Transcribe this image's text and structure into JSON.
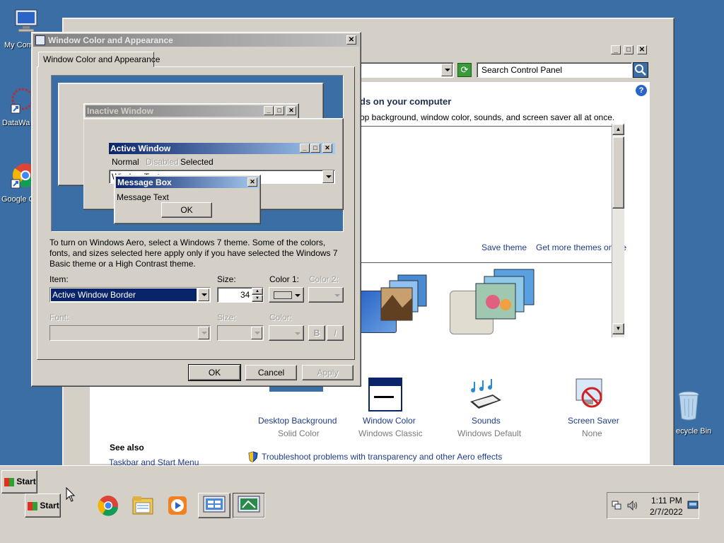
{
  "desktop": {
    "icons": [
      {
        "label": "My Com",
        "icon": "computer-icon"
      },
      {
        "label": "DataWa",
        "icon": "datawatch-icon"
      },
      {
        "label": "Google C",
        "icon": "chrome-icon"
      },
      {
        "label": "ecycle Bin",
        "icon": "recycle-bin-icon"
      }
    ]
  },
  "control_panel": {
    "search_placeholder": "Search Control Panel",
    "heading": "ds on your computer",
    "subheading": "op background, window color, sounds, and screen saver all at once.",
    "save_theme": "Save theme",
    "get_more_themes": "Get more themes online",
    "items": [
      {
        "label": "Desktop Background",
        "sub": "Solid Color"
      },
      {
        "label": "Window Color",
        "sub": "Windows Classic"
      },
      {
        "label": "Sounds",
        "sub": "Windows Default"
      },
      {
        "label": "Screen Saver",
        "sub": "None"
      }
    ],
    "see_also": "See also",
    "taskbar_link": "Taskbar and Start Menu",
    "troubleshoot": "Troubleshoot problems with transparency and other Aero effects"
  },
  "dialog": {
    "title": "Window Color and Appearance",
    "tab": "Window Color and Appearance",
    "preview": {
      "inactive_title": "Inactive Window",
      "active_title": "Active Window",
      "menu_normal": "Normal",
      "menu_disabled": "Disabled",
      "menu_selected": "Selected",
      "window_text": "Window Text",
      "msgbox_title": "Message Box",
      "msgbox_text": "Message Text",
      "msgbox_ok": "OK"
    },
    "info_text": "To turn on Windows Aero, select a Windows 7 theme.  Some of the colors, fonts, and sizes selected here apply only if you have selected the Windows 7 Basic theme or a High Contrast theme.",
    "item_label": "Item:",
    "item_value": "Active Window Border",
    "size_label": "Size:",
    "size_value": "34",
    "color1_label": "Color 1:",
    "color2_label": "Color 2:",
    "font_label": "Font:",
    "font_size_label": "Size:",
    "font_color_label": "Color:",
    "bold": "B",
    "italic": "I",
    "ok": "OK",
    "cancel": "Cancel",
    "apply": "Apply",
    "colors": {
      "active_title_start": "#0a246a",
      "active_title_end": "#a6caf0",
      "inactive_title_start": "#808080",
      "inactive_title_end": "#c0c0c0",
      "preview_bg": "#3a6ea5"
    }
  },
  "taskbar": {
    "start_floating": "Start",
    "start": "Start",
    "time": "1:11 PM",
    "date": "2/7/2022"
  }
}
